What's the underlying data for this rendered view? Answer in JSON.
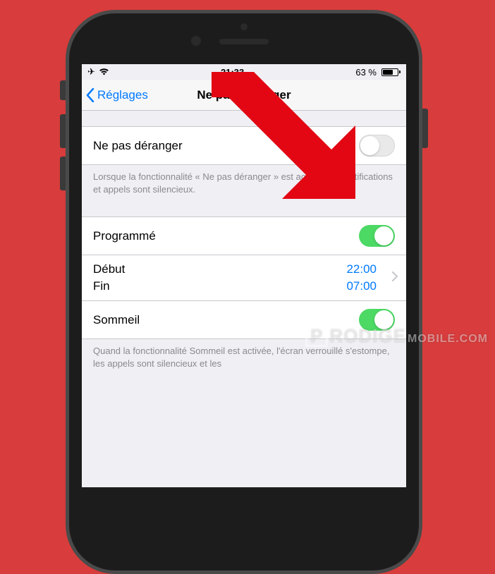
{
  "status_bar": {
    "time": "21:33",
    "battery_percent": "63 %"
  },
  "nav": {
    "back_label": "Réglages",
    "title": "Ne pas déranger"
  },
  "dnd": {
    "row_label": "Ne pas déranger",
    "toggle_on": false,
    "footer": "Lorsque la fonctionnalité « Ne pas déranger » est activée, les notifications et appels sont silencieux."
  },
  "scheduled": {
    "row_label": "Programmé",
    "toggle_on": true,
    "from_label": "Début",
    "from_value": "22:00",
    "to_label": "Fin",
    "to_value": "07:00"
  },
  "sleep": {
    "row_label": "Sommeil",
    "toggle_on": true,
    "footer": "Quand la fonctionnalité Sommeil est activée, l'écran verrouillé s'estompe, les appels sont silencieux et les"
  },
  "watermark": {
    "brand_p": "P",
    "brand_r": "R",
    "brand_odige": "ODIGE",
    "suffix": "MOBILE.COM"
  },
  "colors": {
    "accent_blue": "#007aff",
    "toggle_green": "#4cd964",
    "arrow_red": "#e30613",
    "page_bg": "#d83c3c"
  }
}
